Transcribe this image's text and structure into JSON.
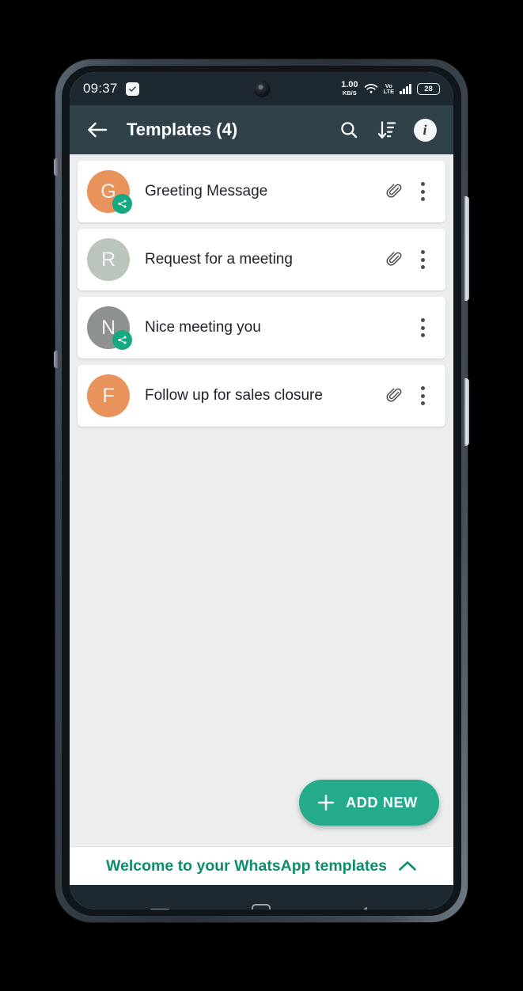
{
  "status_bar": {
    "time": "09:37",
    "check_badge_icon": "checkmark-icon",
    "camera_icon": "front-camera-punch-hole",
    "net_speed_value": "1.00",
    "net_speed_unit": "KB/S",
    "wifi_icon": "wifi-icon",
    "volte_line1": "Vo",
    "volte_line2": "LTE",
    "signal_icon": "cellular-signal-icon",
    "battery_level": "28"
  },
  "app_bar": {
    "back_icon": "back-arrow-icon",
    "title": "Templates (4)",
    "search_icon": "search-icon",
    "sort_icon": "sort-descending-icon",
    "info_icon_letter": "i",
    "background_color": "#31414a"
  },
  "templates": [
    {
      "initial": "G",
      "title": "Greeting Message",
      "avatar_color": "#e8935c",
      "has_share_badge": true,
      "has_attachment": true
    },
    {
      "initial": "R",
      "title": "Request for a meeting",
      "avatar_color": "#bcc5bb",
      "has_share_badge": false,
      "has_attachment": true
    },
    {
      "initial": "N",
      "title": "Nice meeting you",
      "avatar_color": "#8d928e",
      "has_share_badge": true,
      "has_attachment": false
    },
    {
      "initial": "F",
      "title": "Follow up for sales closure",
      "avatar_color": "#e8935c",
      "has_share_badge": false,
      "has_attachment": true
    }
  ],
  "fab": {
    "plus_icon": "plus-icon",
    "label": "ADD NEW",
    "color": "#23ab8b"
  },
  "welcome_banner": {
    "text": "Welcome to your WhatsApp templates",
    "chevron_icon": "chevron-up-icon",
    "color": "#0f8c6b"
  },
  "nav_bar": {
    "recents_icon": "recents-menu-icon",
    "home_icon": "home-square-icon",
    "back_icon": "back-triangle-icon"
  },
  "colors": {
    "accent_green": "#23ab8b",
    "app_bar": "#31414a",
    "status_bar": "#1e2830",
    "page_background": "#eceded"
  }
}
